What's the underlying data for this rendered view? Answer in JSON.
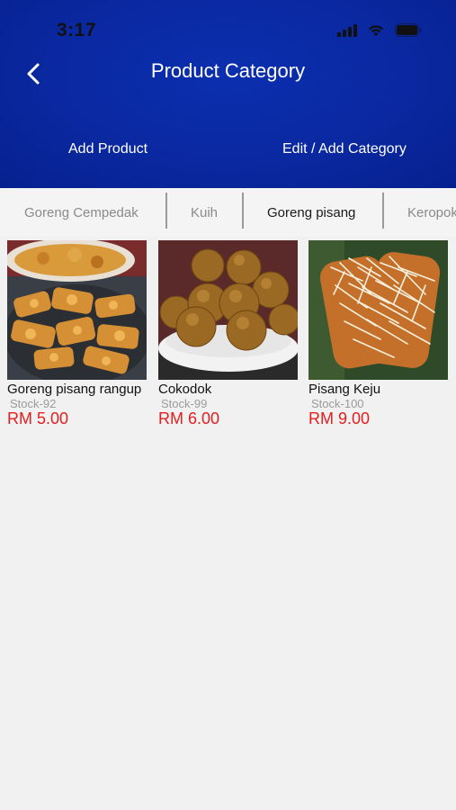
{
  "status_bar": {
    "time": "3:17"
  },
  "header": {
    "title": "Product Category",
    "add_product": "Add Product",
    "edit_category": "Edit / Add Category",
    "background_color": "#0a28a0"
  },
  "tabs": [
    {
      "label": "Goreng Cempedak",
      "active": false
    },
    {
      "label": "Kuih",
      "active": false
    },
    {
      "label": "Goreng pisang",
      "active": true
    },
    {
      "label": "Keropok",
      "active": false
    }
  ],
  "products": [
    {
      "name": "Goreng pisang rangup",
      "stock": "Stock-92",
      "price": "RM 5.00"
    },
    {
      "name": "Cokodok",
      "stock": "Stock-99",
      "price": "RM 6.00"
    },
    {
      "name": "Pisang Keju",
      "stock": "Stock-100",
      "price": "RM 9.00"
    }
  ],
  "colors": {
    "price": "#e41e1e",
    "stock": "#9a9a9a",
    "active_tab": "#1a1a1a",
    "inactive_tab": "#8a8a8a"
  }
}
